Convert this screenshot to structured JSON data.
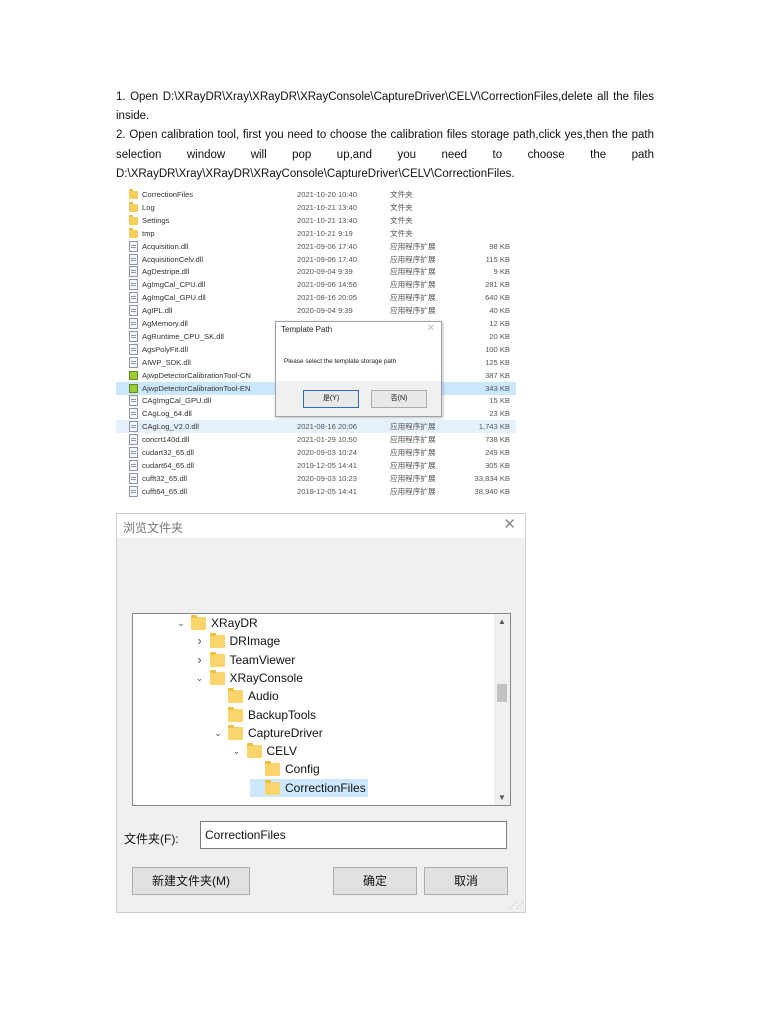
{
  "instructions": [
    "1.  Open  D:\\XRayDR\\Xray\\XRayDR\\XRayConsole\\CaptureDriver\\CELV\\CorrectionFiles,delete  all the files inside.",
    "2.  Open calibration tool, first you need to choose the calibration files storage path,click yes,then the path selection window will pop up,and you need to choose the path D:\\XRayDR\\Xray\\XRayDR\\XRayConsole\\CaptureDriver\\CELV\\CorrectionFiles."
  ],
  "file_list": [
    {
      "name": "CorrectionFiles",
      "date": "2021-10-20 10:40",
      "type": "文件夹",
      "size": "",
      "icon": "folder-icon"
    },
    {
      "name": "Log",
      "date": "2021-10-21 13:40",
      "type": "文件夹",
      "size": "",
      "icon": "folder-icon"
    },
    {
      "name": "Settings",
      "date": "2021-10-21 13:40",
      "type": "文件夹",
      "size": "",
      "icon": "folder-icon"
    },
    {
      "name": "tmp",
      "date": "2021-10-21 9:19",
      "type": "文件夹",
      "size": "",
      "icon": "folder-icon"
    },
    {
      "name": "Acquisition.dll",
      "date": "2021-09-06 17:40",
      "type": "应用程序扩展",
      "size": "98 KB",
      "icon": "dll-icon"
    },
    {
      "name": "AcquisitionCelv.dll",
      "date": "2021-09-06 17:40",
      "type": "应用程序扩展",
      "size": "115 KB",
      "icon": "dll-icon"
    },
    {
      "name": "AgDestripe.dll",
      "date": "2020-09-04 9:39",
      "type": "应用程序扩展",
      "size": "9 KB",
      "icon": "dll-icon"
    },
    {
      "name": "AgImgCal_CPU.dll",
      "date": "2021-09-06 14:56",
      "type": "应用程序扩展",
      "size": "281 KB",
      "icon": "dll-icon"
    },
    {
      "name": "AgImgCal_GPU.dll",
      "date": "2021-08-16 20:05",
      "type": "应用程序扩展",
      "size": "640 KB",
      "icon": "dll-icon"
    },
    {
      "name": "AgIPL.dll",
      "date": "2020-09-04 9:39",
      "type": "应用程序扩展",
      "size": "40 KB",
      "icon": "dll-icon"
    },
    {
      "name": "AgMemory.dll",
      "date": "",
      "type": "",
      "size": "12 KB",
      "icon": "dll-icon"
    },
    {
      "name": "AgRuntime_CPU_SK.dll",
      "date": "",
      "type": "",
      "size": "20 KB",
      "icon": "dll-icon"
    },
    {
      "name": "AgsPolyFit.dll",
      "date": "",
      "type": "",
      "size": "100 KB",
      "icon": "dll-icon"
    },
    {
      "name": "AIWP_SDK.dll",
      "date": "",
      "type": "",
      "size": "125 KB",
      "icon": "dll-icon"
    },
    {
      "name": "AjwpDetectorCalibrationTool-CN",
      "date": "",
      "type": "",
      "size": "387 KB",
      "icon": "app-icon"
    },
    {
      "name": "AjwpDetectorCalibrationTool-EN",
      "date": "",
      "type": "",
      "size": "343 KB",
      "icon": "app-icon",
      "selected": true
    },
    {
      "name": "CAgImgCal_GPU.dll",
      "date": "",
      "type": "",
      "size": "15 KB",
      "icon": "dll-icon"
    },
    {
      "name": "CAgLog_64.dll",
      "date": "",
      "type": "",
      "size": "23 KB",
      "icon": "dll-icon"
    },
    {
      "name": "CAgLog_V2.0.dll",
      "date": "2021-08-16 20:06",
      "type": "应用程序扩展",
      "size": "1,743 KB",
      "icon": "dll-icon",
      "hover": true
    },
    {
      "name": "concrt140d.dll",
      "date": "2021-01-29 10:50",
      "type": "应用程序扩展",
      "size": "738 KB",
      "icon": "dll-icon"
    },
    {
      "name": "cudart32_65.dll",
      "date": "2020-09-03 10:24",
      "type": "应用程序扩展",
      "size": "249 KB",
      "icon": "dll-icon"
    },
    {
      "name": "cudart64_65.dll",
      "date": "2019-12-05 14:41",
      "type": "应用程序扩展",
      "size": "305 KB",
      "icon": "dll-icon"
    },
    {
      "name": "cufft32_65.dll",
      "date": "2020-09-03 10:23",
      "type": "应用程序扩展",
      "size": "33,834 KB",
      "icon": "dll-icon"
    },
    {
      "name": "cufft64_65.dll",
      "date": "2019-12-05 14:41",
      "type": "应用程序扩展",
      "size": "38,940 KB",
      "icon": "dll-icon"
    }
  ],
  "template_dialog": {
    "title": "Template Path",
    "message": "Please select the template storage path",
    "yes_label": "是(Y)",
    "no_label": "否(N)"
  },
  "browse_dialog": {
    "title": "浏览文件夹",
    "tree": [
      {
        "label": "XRayDR",
        "depth": 0,
        "chevron": "expanded"
      },
      {
        "label": "DRImage",
        "depth": 1,
        "chevron": "collapsed"
      },
      {
        "label": "TeamViewer",
        "depth": 1,
        "chevron": "collapsed"
      },
      {
        "label": "XRayConsole",
        "depth": 1,
        "chevron": "expanded"
      },
      {
        "label": "Audio",
        "depth": 2,
        "chevron": "none"
      },
      {
        "label": "BackupTools",
        "depth": 2,
        "chevron": "none"
      },
      {
        "label": "CaptureDriver",
        "depth": 2,
        "chevron": "expanded"
      },
      {
        "label": "CELV",
        "depth": 3,
        "chevron": "expanded"
      },
      {
        "label": "Config",
        "depth": 4,
        "chevron": "none"
      },
      {
        "label": "CorrectionFiles",
        "depth": 4,
        "chevron": "none",
        "selected": true
      }
    ],
    "folder_label": "文件夹(F):",
    "folder_value": "CorrectionFiles",
    "new_folder_label": "新建文件夹(M)",
    "ok_label": "确定",
    "cancel_label": "取消"
  }
}
